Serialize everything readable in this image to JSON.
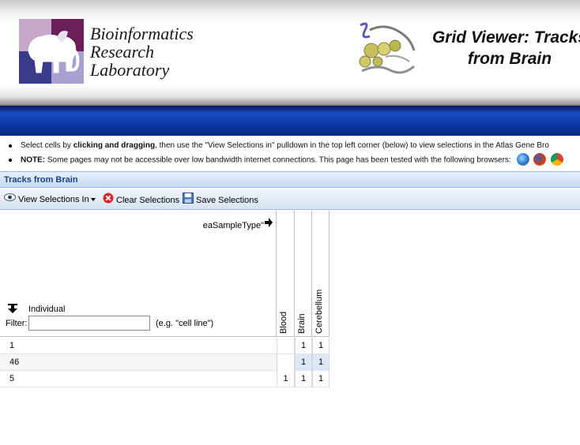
{
  "header": {
    "logo_text_lines": [
      "Bioinformatics",
      "Research",
      "Laboratory"
    ],
    "title_lines": [
      "Grid Viewer: Tracks",
      "from Brain"
    ]
  },
  "notes": {
    "select_prefix": "Select cells by ",
    "select_bold": "clicking and dragging",
    "select_suffix": ", then use the \"View Selections in\" pulldown in the top left corner (below) to view selections in the Atlas Gene Bro",
    "note_label": "NOTE:",
    "note_text": " Some pages may not be accessible over low bandwidth internet connections. This page has been tested with the following browsers:",
    "browser_icons": [
      "ie-icon",
      "firefox-icon",
      "chrome-icon"
    ]
  },
  "panel": {
    "title": "Tracks from Brain"
  },
  "toolbar": {
    "view_label": "View Selections In",
    "clear_label": "Clear Selections",
    "save_label": "Save Selections"
  },
  "grid": {
    "column_dimension": "eaSampleType\"",
    "row_dimension": "Individual",
    "filter_label": "Filter:",
    "filter_value": "",
    "filter_hint": "(e.g. \"cell line\")",
    "columns": [
      "Blood",
      "Brain",
      "Cerebellum"
    ],
    "rows": [
      {
        "label": "1",
        "cells": [
          "",
          "1",
          "1"
        ]
      },
      {
        "label": "46",
        "cells": [
          "",
          "1",
          "1"
        ]
      },
      {
        "label": "5",
        "cells": [
          "1",
          "1",
          "1"
        ]
      }
    ]
  },
  "colors": {
    "accent": "#15428b",
    "band": "#0c3aa8",
    "selected_cell": "#dce8f6"
  }
}
